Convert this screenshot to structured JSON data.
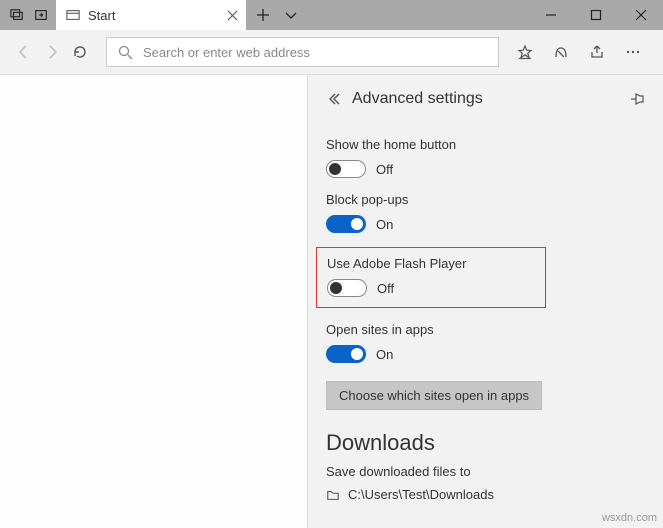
{
  "tab": {
    "title": "Start"
  },
  "addressbar": {
    "placeholder": "Search or enter web address"
  },
  "pane": {
    "title": "Advanced settings",
    "show_home": {
      "label": "Show the home button",
      "state": "Off",
      "on": false
    },
    "block_popups": {
      "label": "Block pop-ups",
      "state": "On",
      "on": true
    },
    "flash": {
      "label": "Use Adobe Flash Player",
      "state": "Off",
      "on": false
    },
    "open_sites": {
      "label": "Open sites in apps",
      "state": "On",
      "on": true
    },
    "choose_button": "Choose which sites open in apps",
    "downloads_heading": "Downloads",
    "save_files_label": "Save downloaded files to",
    "save_path": "C:\\Users\\Test\\Downloads"
  },
  "watermark": "wsxdn.com"
}
